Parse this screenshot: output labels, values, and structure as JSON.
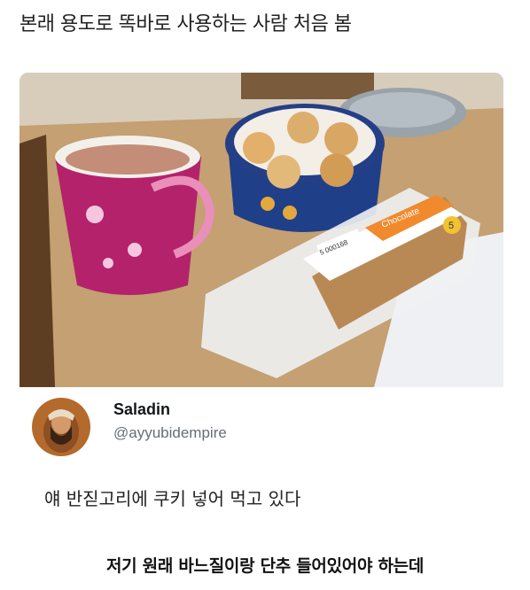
{
  "post": {
    "title": "본래 용도로 똑바로 사용하는 사람 처음 봄"
  },
  "tweet": {
    "display_name": "Saladin",
    "handle": "@ayyubidempire",
    "text": "얘 반짇고리에 쿠키 넣어 먹고 있다"
  },
  "photo": {
    "label_text": "Chocolate",
    "barcode_text": "5 000168",
    "price_badge": "5"
  },
  "caption": "저기 원래 바느질이랑 단추 들어있어야 하는데"
}
